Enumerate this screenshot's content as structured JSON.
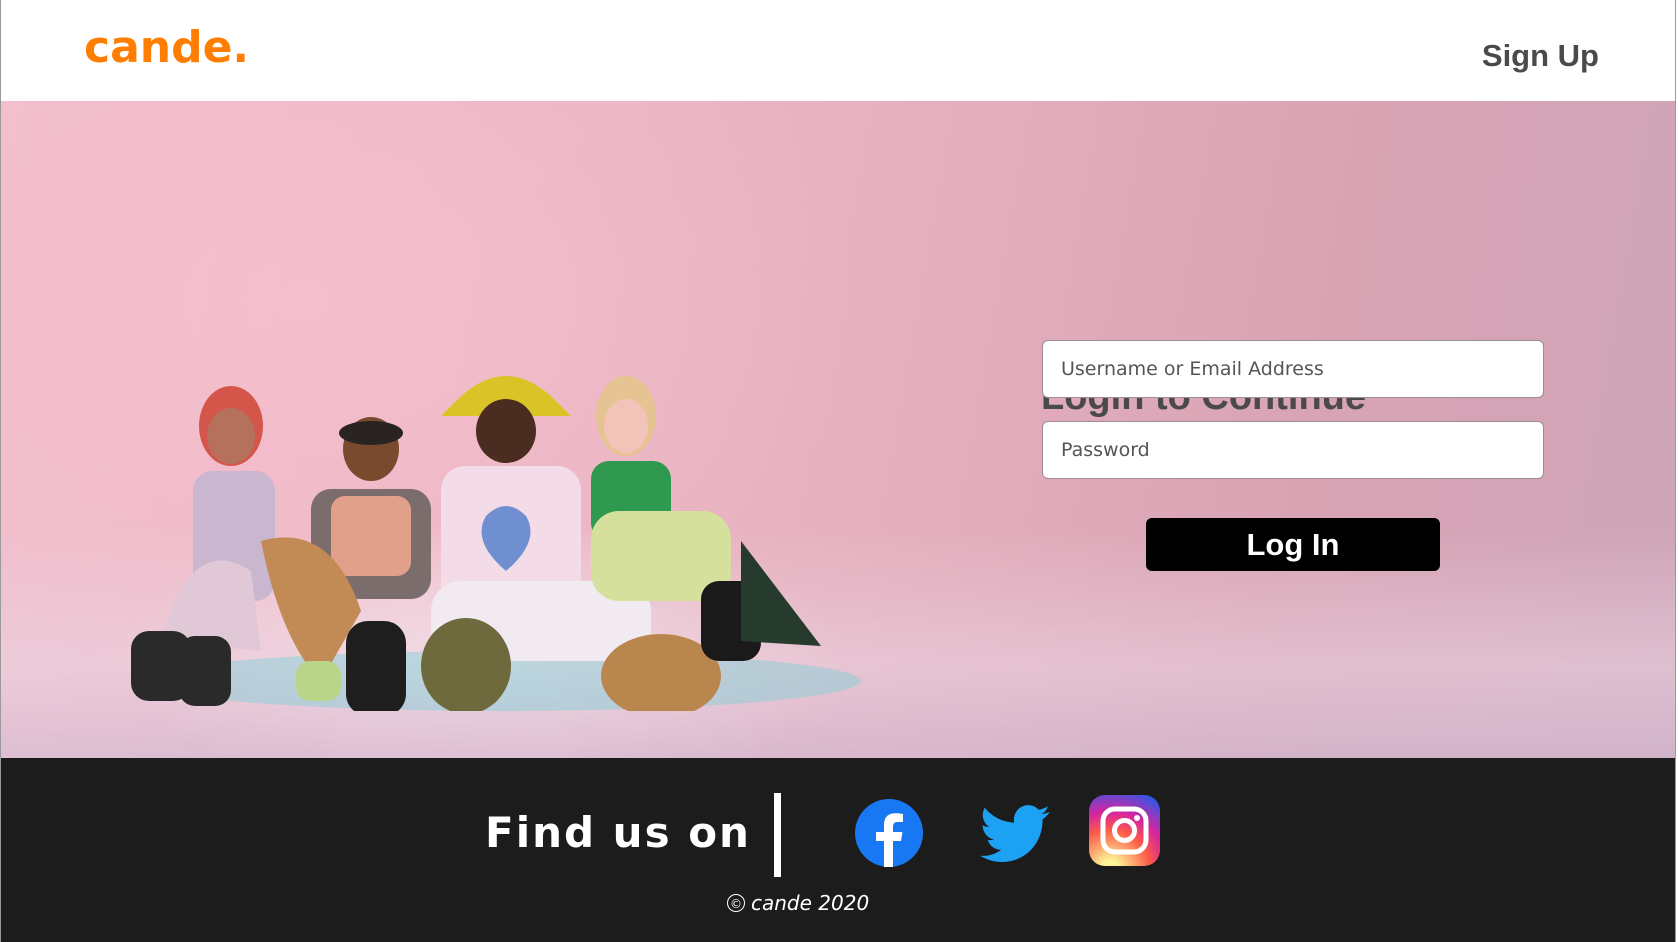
{
  "header": {
    "logo": "cande.",
    "signup_label": "Sign Up"
  },
  "hero": {
    "image_icon": "group-photo-image"
  },
  "login": {
    "title": "Login to Continue",
    "username_placeholder": "Username or Email Address",
    "username_value": "",
    "password_placeholder": "Password",
    "password_value": "",
    "button_label": "Log In"
  },
  "footer": {
    "find_us": "Find us on",
    "social": [
      {
        "icon": "facebook-icon",
        "color": "#1877f2"
      },
      {
        "icon": "twitter-icon",
        "color": "#1da1f2"
      },
      {
        "icon": "instagram-icon",
        "color": "#d6249f"
      }
    ],
    "copyright_symbol": "©",
    "copyright": "cande 2020"
  },
  "colors": {
    "brand": "#ff7d00",
    "footer_bg": "#1c1c1c",
    "button_bg": "#000000",
    "text_dark": "#4a4a4a"
  }
}
